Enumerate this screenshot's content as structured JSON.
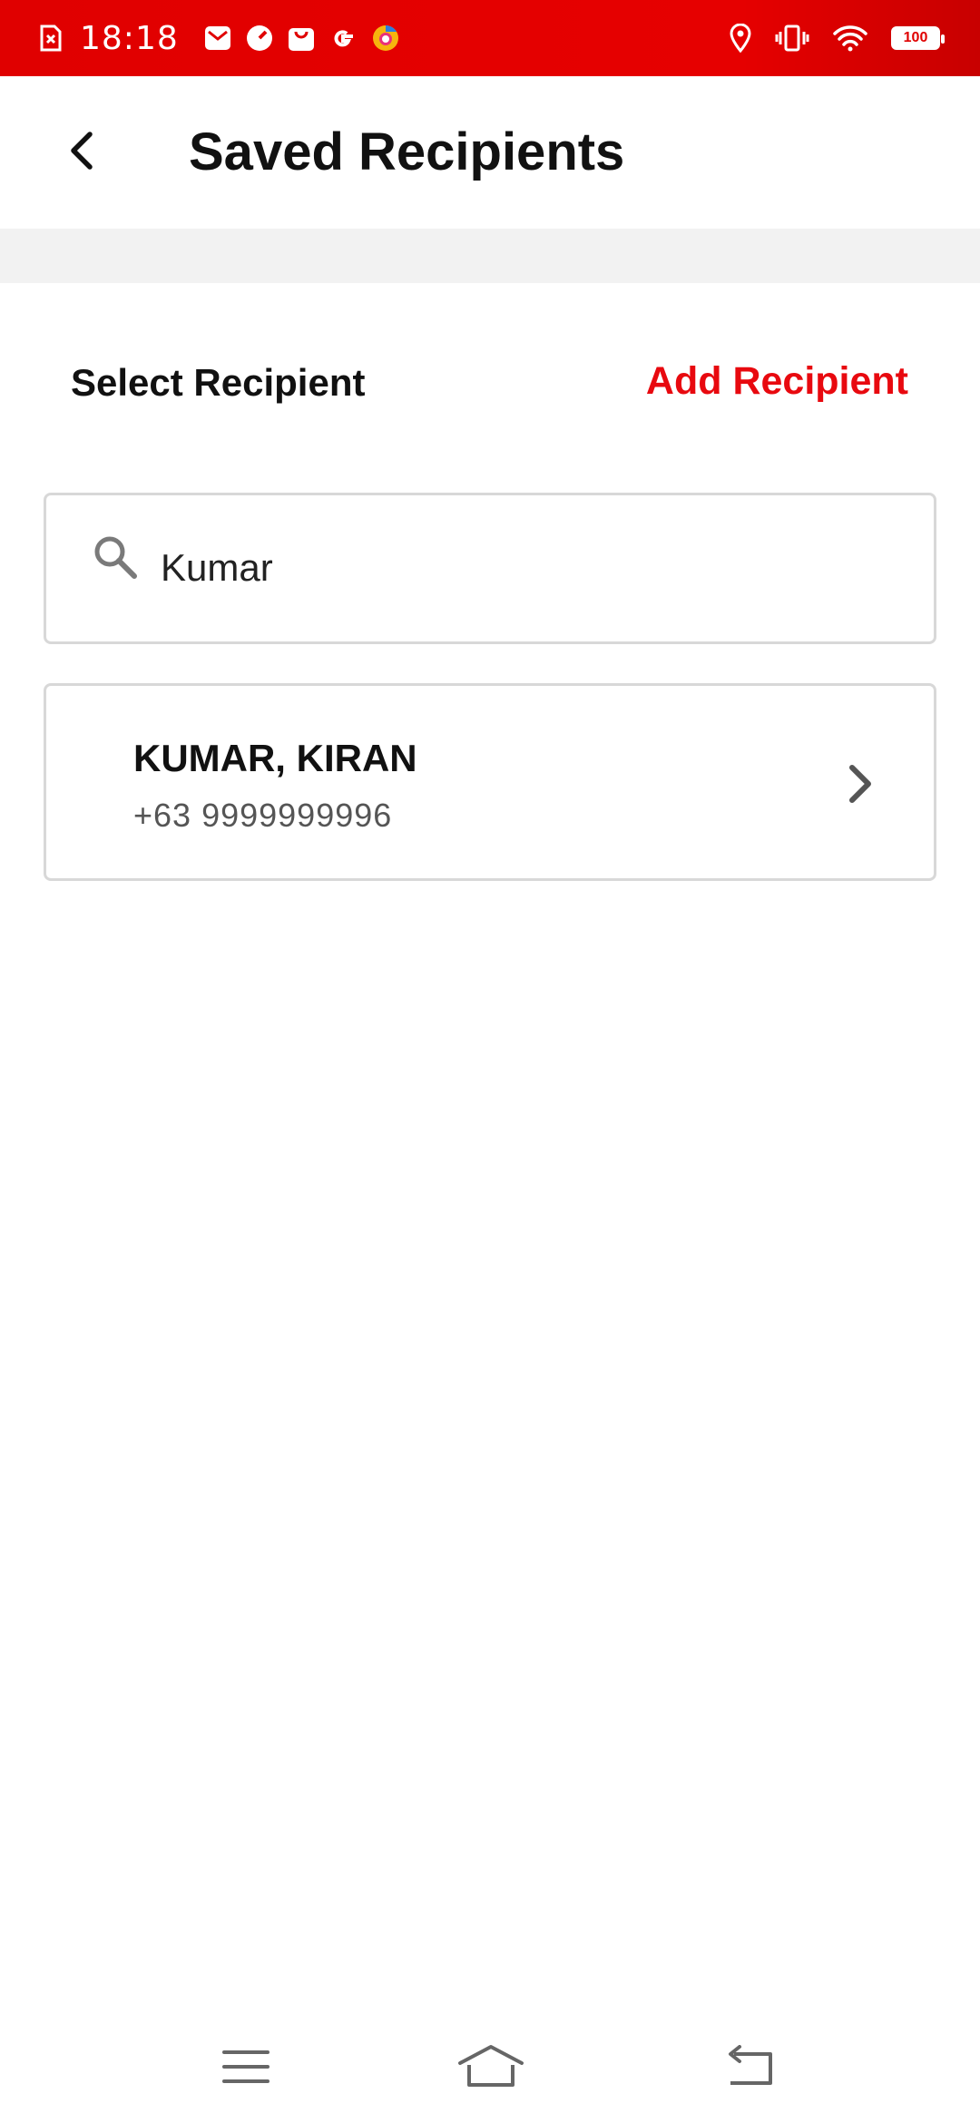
{
  "status_bar": {
    "time": "18:18",
    "battery": "100",
    "left_icons": [
      "sim-error-icon",
      "mail-icon",
      "speedometer-icon",
      "shopping-bag-icon",
      "google-icon",
      "browser-icon"
    ],
    "right_icons": [
      "location-icon",
      "vibrate-icon",
      "wifi-icon",
      "battery-icon"
    ],
    "background_color": "#e00000"
  },
  "header": {
    "title": "Saved Recipients",
    "back_icon": "chevron-left-icon"
  },
  "section": {
    "select_label": "Select Recipient",
    "add_label": "Add Recipient",
    "accent_color": "#e8090f"
  },
  "search": {
    "value": "Kumar",
    "icon": "search-icon"
  },
  "recipients": [
    {
      "name": "KUMAR, KIRAN",
      "phone": "+63 9999999996"
    }
  ],
  "nav_bar": {
    "icons": [
      "menu-icon",
      "home-icon",
      "back-icon"
    ]
  }
}
